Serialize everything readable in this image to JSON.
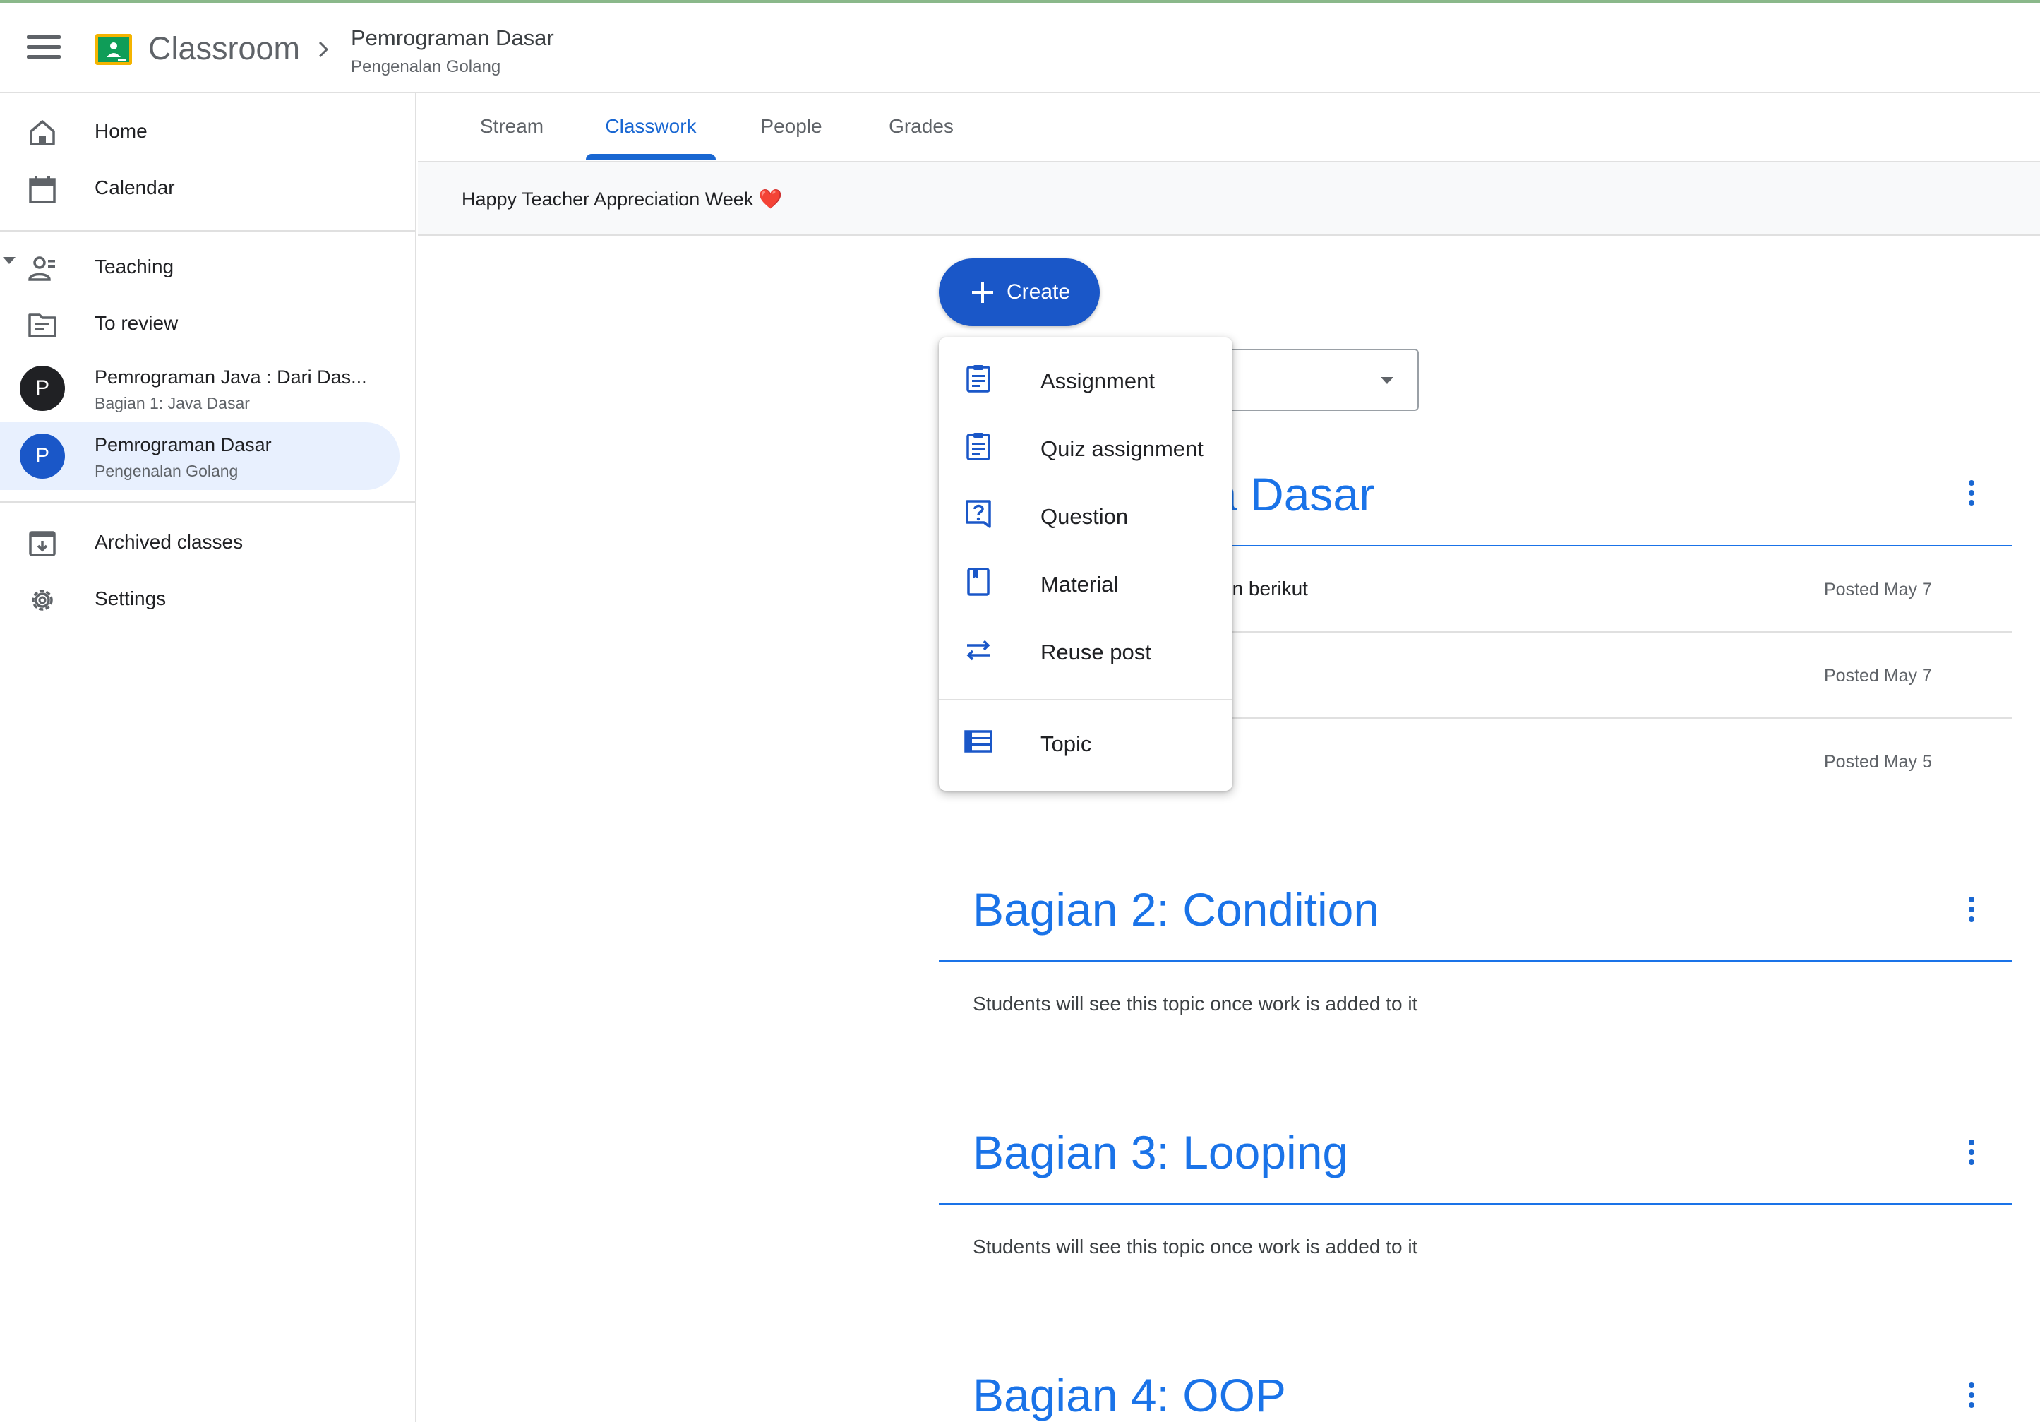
{
  "app": {
    "title": "Classroom"
  },
  "breadcrumb": {
    "course": "Pemrograman Dasar",
    "section": "Pengenalan Golang"
  },
  "sidebar": {
    "home": "Home",
    "calendar": "Calendar",
    "teaching": "Teaching",
    "to_review": "To review",
    "courses": [
      {
        "avatar": "P",
        "title": "Pemrograman Java : Dari Das...",
        "subtitle": "Bagian 1: Java Dasar",
        "color": "#202124"
      },
      {
        "avatar": "P",
        "title": "Pemrograman Dasar",
        "subtitle": "Pengenalan Golang",
        "color": "#1a57c8"
      }
    ],
    "archived": "Archived classes",
    "settings": "Settings"
  },
  "tabs": {
    "stream": "Stream",
    "classwork": "Classwork",
    "people": "People",
    "grades": "Grades"
  },
  "banner": {
    "text": "Happy Teacher Appreciation Week",
    "emoji": "❤️"
  },
  "create_button": {
    "label": "Create"
  },
  "create_menu": {
    "assignment": "Assignment",
    "quiz": "Quiz assignment",
    "question": "Question",
    "material": "Material",
    "reuse": "Reuse post",
    "topic": "Topic"
  },
  "topics": [
    {
      "title_visible": "a Dasar",
      "rows": [
        {
          "text": "an berikut",
          "date": "Posted May 7"
        },
        {
          "text": "",
          "date": "Posted May 7"
        },
        {
          "text": "",
          "date": "Posted May 5"
        }
      ]
    },
    {
      "title": "Bagian 2: Condition",
      "empty": "Students will see this topic once work is added to it"
    },
    {
      "title": "Bagian 3: Looping",
      "empty": "Students will see this topic once work is added to it"
    },
    {
      "title": "Bagian 4: OOP"
    }
  ],
  "colors": {
    "accent": "#1a73e8",
    "create_button": "#1a57c8",
    "active_course_bg": "#e8f0fe"
  }
}
